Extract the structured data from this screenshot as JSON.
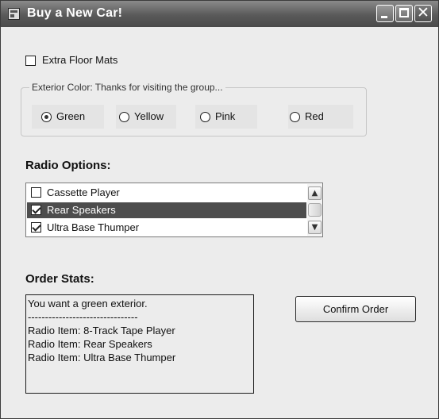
{
  "window": {
    "title": "Buy a New Car!",
    "icon": "app-form-icon",
    "caption_buttons": {
      "minimize_icon": "minimize-icon",
      "maximize_icon": "maximize-icon",
      "close_glyph": "✕"
    }
  },
  "floor_mats": {
    "label": "Extra Floor Mats",
    "checked": false
  },
  "exterior_color": {
    "legend": "Exterior Color: Thanks for visiting the group...",
    "options": [
      {
        "label": "Green",
        "checked": true
      },
      {
        "label": "Yellow",
        "checked": false
      },
      {
        "label": "Pink",
        "checked": false
      },
      {
        "label": "Red",
        "checked": false
      }
    ]
  },
  "radio_options": {
    "title": "Radio Options:",
    "items": [
      {
        "label": "Cassette Player",
        "checked": false,
        "selected": false
      },
      {
        "label": "Rear Speakers",
        "checked": true,
        "selected": true
      },
      {
        "label": "Ultra Base Thumper",
        "checked": true,
        "selected": false
      }
    ],
    "scroll_up_glyph": "▲",
    "scroll_down_glyph": "▼"
  },
  "order_stats": {
    "title": "Order Stats:",
    "lines": [
      "You want a green exterior.",
      "--------------------------------",
      "Radio Item: 8-Track Tape Player",
      "Radio Item: Rear Speakers",
      "Radio Item: Ultra Base Thumper"
    ]
  },
  "confirm_button": {
    "label": "Confirm Order"
  },
  "colors": {
    "titlebar": "#5a5a5a",
    "form_background": "#ececec",
    "selection": "#4d4d4d"
  }
}
